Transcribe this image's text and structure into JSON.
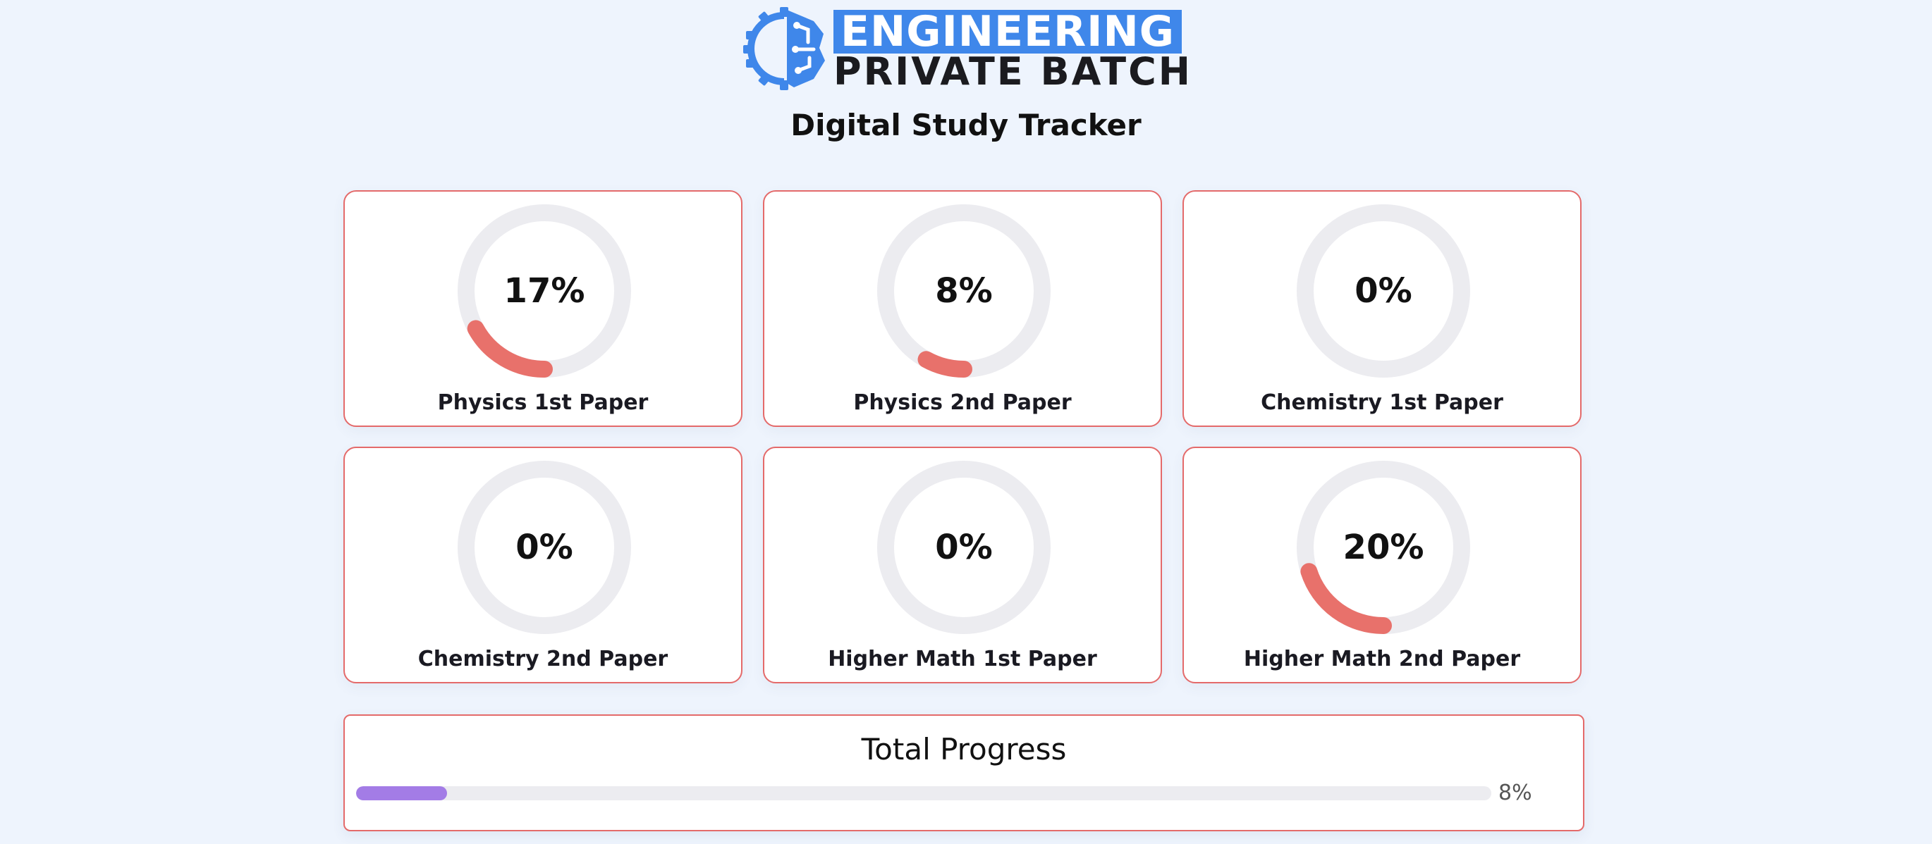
{
  "brand": {
    "line1": "ENGINEERING",
    "line2": "PRIVATE BATCH",
    "accent_color": "#3f87ea",
    "icon": "gear-circuit-logo"
  },
  "page": {
    "title": "Digital Study Tracker"
  },
  "subjects": [
    {
      "name": "Physics 1st Paper",
      "percent_text": "17%",
      "progress": 17
    },
    {
      "name": "Physics 2nd Paper",
      "percent_text": "8%",
      "progress": 8
    },
    {
      "name": "Chemistry 1st Paper",
      "percent_text": "0%",
      "progress": 0
    },
    {
      "name": "Chemistry 2nd Paper",
      "percent_text": "0%",
      "progress": 0
    },
    {
      "name": "Higher Math 1st Paper",
      "percent_text": "0%",
      "progress": 0
    },
    {
      "name": "Higher Math 2nd Paper",
      "percent_text": "20%",
      "progress": 20
    }
  ],
  "total": {
    "title": "Total Progress",
    "percent_text": "8%",
    "progress": 8
  },
  "colors": {
    "ring_progress": "#e8716b",
    "ring_track": "#ececf0",
    "card_border": "#e46a6a",
    "total_fill": "#a37ce6",
    "total_track": "#ececf0",
    "background": "#eef4fd"
  }
}
